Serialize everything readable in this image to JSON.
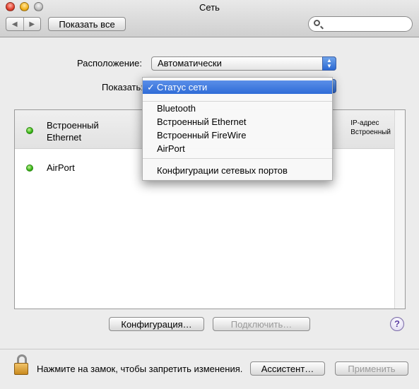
{
  "window": {
    "title": "Сеть"
  },
  "toolbar": {
    "back_glyph": "◀",
    "forward_glyph": "▶",
    "show_all_label": "Показать все",
    "search_value": ""
  },
  "location": {
    "label": "Расположение:",
    "value": "Автоматически"
  },
  "show": {
    "label": "Показать:"
  },
  "menu": {
    "selected": "Статус сети",
    "checkmark": "✓",
    "items": [
      "Bluetooth",
      "Встроенный Ethernet",
      "Встроенный FireWire",
      "AirPort"
    ],
    "footer_item": "Конфигурации сетевых портов"
  },
  "services": [
    {
      "name_line1": "Встроенный",
      "name_line2": "Ethernet",
      "status_color": "#35b316",
      "detail_line1": "IP-адрес",
      "detail_line2": "Встроенный"
    },
    {
      "name_line1": "AirPort",
      "status_color": "#35b316"
    }
  ],
  "buttons": {
    "configure": "Конфигурация…",
    "connect": "Подключить…",
    "help": "?",
    "assistant": "Ассистент…",
    "apply": "Применить"
  },
  "lock_text": "Нажмите на замок, чтобы запретить изменения."
}
